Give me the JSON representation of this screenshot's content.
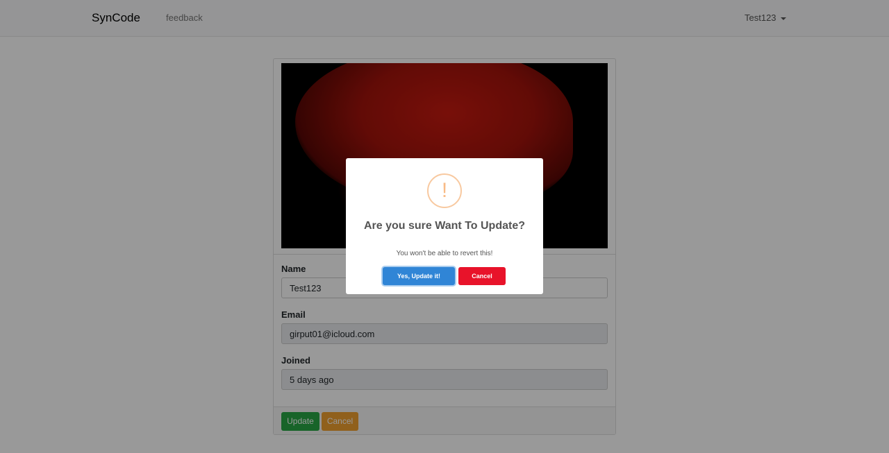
{
  "navbar": {
    "brand": "SynCode",
    "feedback": "feedback",
    "user": "Test123"
  },
  "profile": {
    "name_label": "Name",
    "name_value": "Test123",
    "email_label": "Email",
    "email_value": "girput01@icloud.com",
    "joined_label": "Joined",
    "joined_value": "5 days ago",
    "update_label": "Update",
    "cancel_label": "Cancel"
  },
  "modal": {
    "icon": "!",
    "title": "Are you sure Want To Update?",
    "text": "You won't be able to revert this!",
    "confirm_label": "Yes, Update it!",
    "cancel_label": "Cancel",
    "confirm_color": "#3085d6",
    "cancel_color": "#e8132a"
  }
}
